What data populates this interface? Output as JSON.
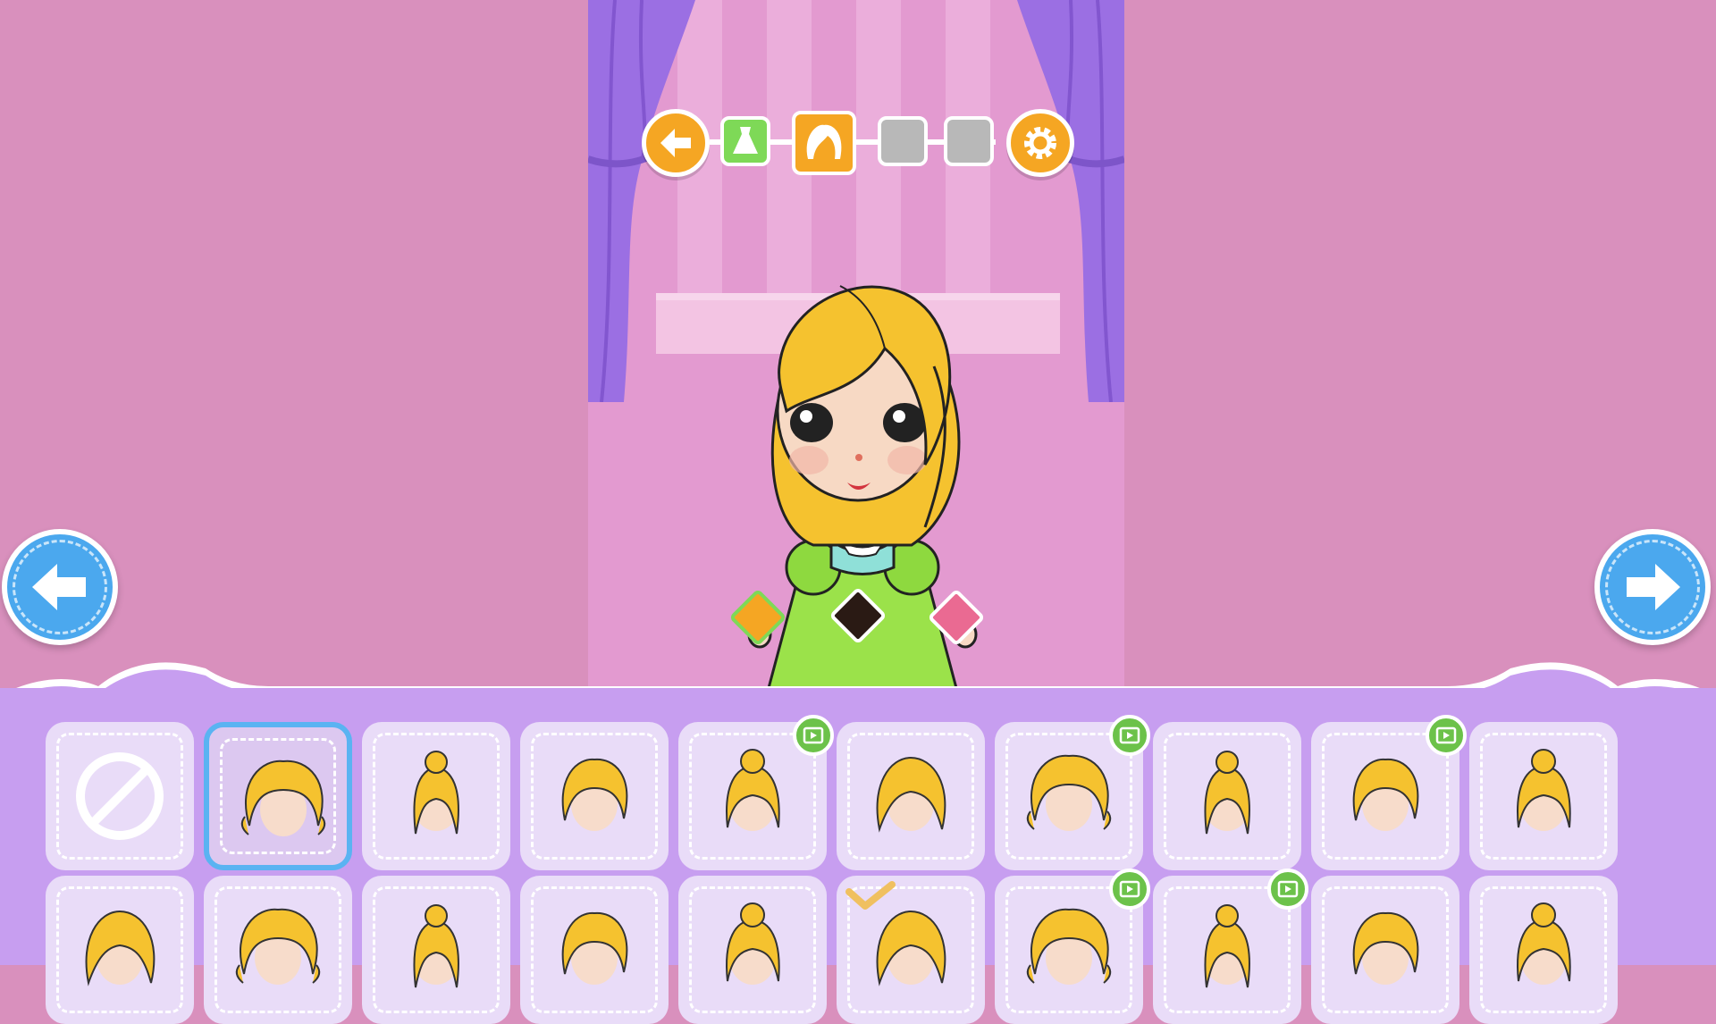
{
  "colors": {
    "background": "#d990bd",
    "stage": "#e39ad0",
    "curtain": "#9b6fe3",
    "accent_orange": "#f5a623",
    "arrow_blue": "#4ba8ee",
    "panel": "#c79ef0",
    "slot": "#e9dcf8",
    "video_badge": "#6cc24a"
  },
  "topbar": {
    "back_icon": "arrow-left-icon",
    "steps": [
      {
        "name": "dress-step",
        "icon": "dress-icon",
        "state": "done",
        "color": "#7ed957"
      },
      {
        "name": "hair-step",
        "icon": "hair-icon",
        "state": "active",
        "color": "#f5a623"
      },
      {
        "name": "step-3",
        "icon": "",
        "state": "locked",
        "color": "#b8b8b8"
      },
      {
        "name": "step-4",
        "icon": "",
        "state": "locked",
        "color": "#b8b8b8"
      }
    ],
    "settings_icon": "gear-icon"
  },
  "color_swatches": [
    {
      "name": "color-swatch-orange",
      "color": "#f5a623",
      "selected": true
    },
    {
      "name": "color-swatch-black",
      "color": "#2a1a14",
      "selected": false
    },
    {
      "name": "color-swatch-pink",
      "color": "#ea6a92",
      "selected": false
    }
  ],
  "hair_options": [
    {
      "id": "none",
      "icon": "none-icon",
      "video": false
    },
    {
      "id": "hair-1",
      "selected": true,
      "video": false
    },
    {
      "id": "hair-2",
      "video": false
    },
    {
      "id": "hair-3",
      "video": false
    },
    {
      "id": "hair-4",
      "video": true
    },
    {
      "id": "hair-5",
      "video": false
    },
    {
      "id": "hair-6",
      "video": true
    },
    {
      "id": "hair-7",
      "video": false
    },
    {
      "id": "hair-8",
      "video": true
    },
    {
      "id": "hair-9",
      "video": false
    },
    {
      "id": "hair-10",
      "video": false
    },
    {
      "id": "hair-11",
      "video": false
    },
    {
      "id": "hair-12",
      "video": false
    },
    {
      "id": "hair-13",
      "video": false
    },
    {
      "id": "hair-14",
      "video": false
    },
    {
      "id": "hair-15",
      "video": false,
      "checkmark": true
    },
    {
      "id": "hair-16",
      "video": true
    },
    {
      "id": "hair-17",
      "video": true
    },
    {
      "id": "hair-18",
      "video": false
    },
    {
      "id": "hair-19",
      "video": false
    }
  ]
}
